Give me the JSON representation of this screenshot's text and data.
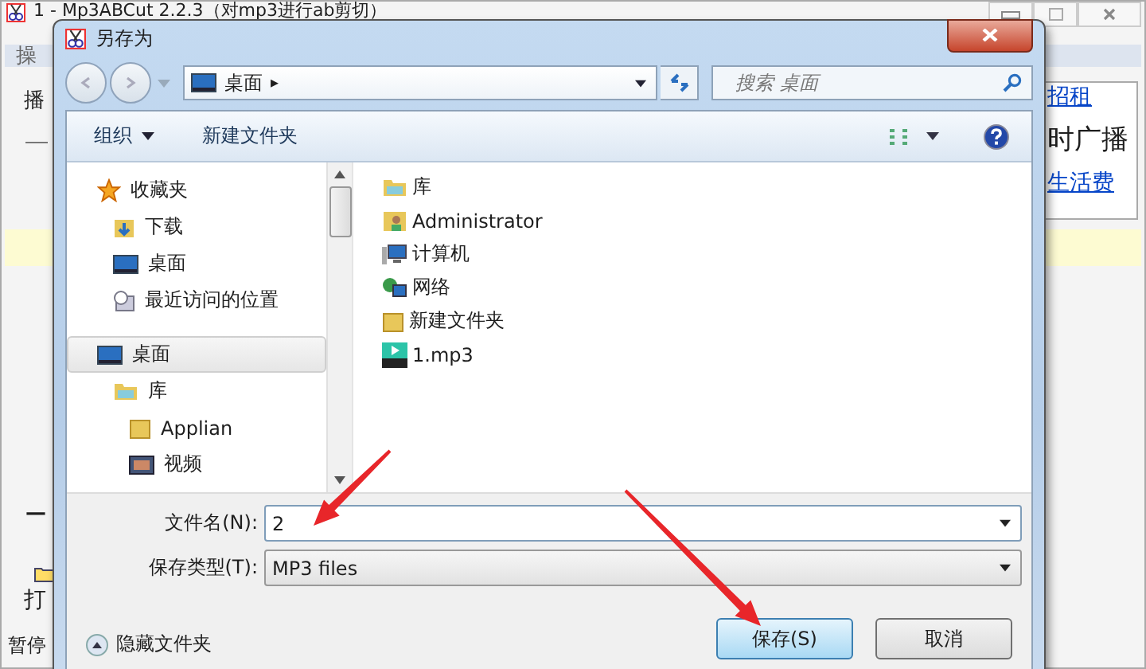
{
  "background_window": {
    "title": "1 - Mp3ABCut 2.2.3（对mp3进行ab剪切）",
    "menu_fragment": "操",
    "left_fragments": [
      "播",
      "—",
      "打",
      "暂停"
    ],
    "links": [
      {
        "text": "招租",
        "kind": "link"
      },
      {
        "text": "时广播",
        "kind": "plain"
      },
      {
        "text": "生活费",
        "kind": "link"
      }
    ]
  },
  "dialog": {
    "title": "另存为",
    "address": {
      "path": "桌面",
      "arrow": "▸"
    },
    "search": {
      "placeholder": "搜索 桌面"
    },
    "toolbar": {
      "organize": "组织",
      "new_folder": "新建文件夹"
    },
    "nav": [
      {
        "label": "收藏夹",
        "selected": false,
        "children": [
          {
            "label": "下载",
            "selected": false
          },
          {
            "label": "桌面",
            "selected": false
          },
          {
            "label": "最近访问的位置",
            "selected": false
          }
        ]
      },
      {
        "label": "桌面",
        "selected": true,
        "children": [
          {
            "label": "库",
            "selected": false,
            "children": [
              {
                "label": "Applian",
                "selected": false
              },
              {
                "label": "视频",
                "selected": false
              }
            ]
          }
        ]
      }
    ],
    "files": [
      {
        "name": "库"
      },
      {
        "name": "Administrator"
      },
      {
        "name": "计算机"
      },
      {
        "name": "网络"
      },
      {
        "name": "新建文件夹"
      },
      {
        "name": "1.mp3"
      }
    ],
    "filename": {
      "label": "文件名(N):",
      "value": "2"
    },
    "filetype": {
      "label": "保存类型(T):",
      "value": "MP3 files"
    },
    "hide_folders": "隐藏文件夹",
    "buttons": [
      {
        "label": "保存(S)",
        "kind": "primary"
      },
      {
        "label": "取消",
        "kind": "normal"
      }
    ]
  },
  "annotations": [
    {
      "kind": "arrow"
    },
    {
      "kind": "arrow"
    }
  ]
}
